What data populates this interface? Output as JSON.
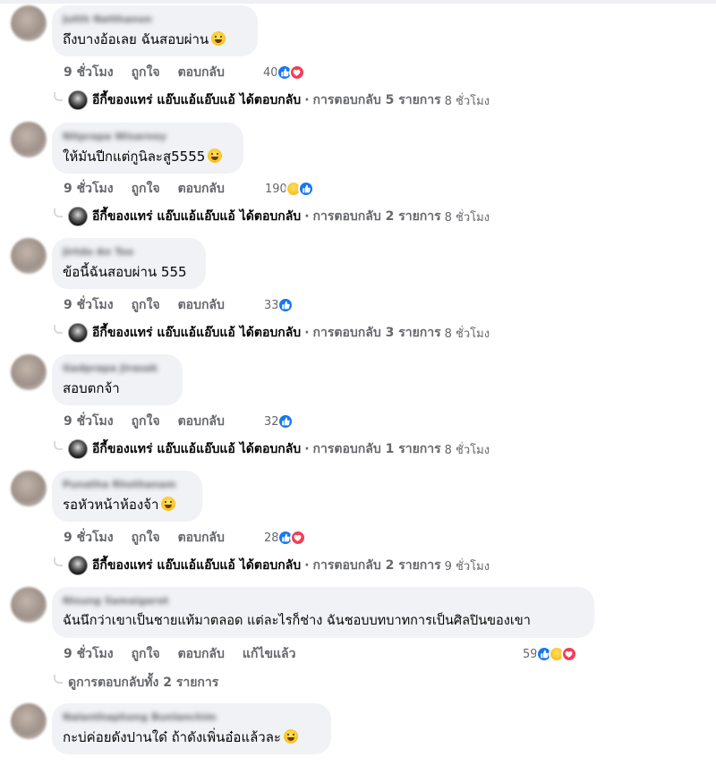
{
  "comments": [
    {
      "author": "Jutth Natthanon",
      "text": "ถึงบางอ้อเลย ฉันสอบผ่าน",
      "time": "9 ชั่วโมง",
      "like": "ถูกใจ",
      "reply": "ตอบกลับ",
      "reaction_count": "40",
      "reaction_icons": [
        "like-icon",
        "love-icon"
      ],
      "replies_text": "อีกี้ของแทร่ แอ๊บแอ้แอ๊บแอ้ ได้ตอบกลับ",
      "replies_count": "การตอบกลับ 5 รายการ",
      "replies_time": "8 ชั่วโมง"
    },
    {
      "author": "Nitprapa Wisarnoy",
      "text": "ให้มันปีกแต่กูนิละสู5555",
      "time": "9 ชั่วโมง",
      "like": "ถูกใจ",
      "reply": "ตอบกลับ",
      "reaction_count": "190",
      "reaction_icons": [
        "haha-icon",
        "like-icon"
      ],
      "replies_text": "อีกี้ของแทร่ แอ๊บแอ้แอ๊บแอ้ ได้ตอบกลับ",
      "replies_count": "การตอบกลับ 2 รายการ",
      "replies_time": "8 ชั่วโมง"
    },
    {
      "author": "Jirtdo An Too",
      "text": "ข้อนี้ฉันสอบผ่าน 555",
      "time": "9 ชั่วโมง",
      "like": "ถูกใจ",
      "reply": "ตอบกลับ",
      "reaction_count": "33",
      "reaction_icons": [
        "like-icon"
      ],
      "replies_text": "อีกี้ของแทร่ แอ๊บแอ้แอ๊บแอ้ ได้ตอบกลับ",
      "replies_count": "การตอบกลับ 3 รายการ",
      "replies_time": "8 ชั่วโมง"
    },
    {
      "author": "Gadprapa Jirasak",
      "text": "สอบตกจ้า",
      "time": "9 ชั่วโมง",
      "like": "ถูกใจ",
      "reply": "ตอบกลับ",
      "reaction_count": "32",
      "reaction_icons": [
        "like-icon"
      ],
      "replies_text": "อีกี้ของแทร่ แอ๊บแอ้แอ๊บแอ้ ได้ตอบกลับ",
      "replies_count": "การตอบกลับ 1 รายการ",
      "replies_time": "8 ชั่วโมง"
    },
    {
      "author": "Punatha Rhothanam",
      "text": "รอหัวหน้าห้องจ้า",
      "time": "9 ชั่วโมง",
      "like": "ถูกใจ",
      "reply": "ตอบกลับ",
      "reaction_count": "28",
      "reaction_icons": [
        "like-icon",
        "love-icon"
      ],
      "replies_text": "อีกี้ของแทร่ แอ๊บแอ้แอ๊บแอ้ ได้ตอบกลับ",
      "replies_count": "การตอบกลับ 2 รายการ",
      "replies_time": "9 ชั่วโมง"
    },
    {
      "author": "Nisung Samaigarot",
      "text": "ฉันนึกว่าเขาเป็นชายแท้มาตลอด แต่ละไรก็ช่าง ฉันชอบบทบาทการเป็นศิลปินของเขา",
      "time": "9 ชั่วโมง",
      "like": "ถูกใจ",
      "reply": "ตอบกลับ",
      "edited": "แก้ไขแล้ว",
      "reaction_count": "59",
      "reaction_icons": [
        "like-icon",
        "care-icon",
        "love-icon"
      ],
      "view_replies": "ดูการตอบกลับทั้ง 2 รายการ"
    },
    {
      "author": "Nalanthaphong Bunlanchim",
      "text": "กะบ่ค่อยดังปานใด๋ ถ้าดังเพิ่นอ๋อแล้วละ"
    }
  ],
  "colors": {
    "bubble": "#f0f2f5",
    "meta": "#65676b",
    "like": "#1877f2",
    "love": "#f33e58"
  }
}
